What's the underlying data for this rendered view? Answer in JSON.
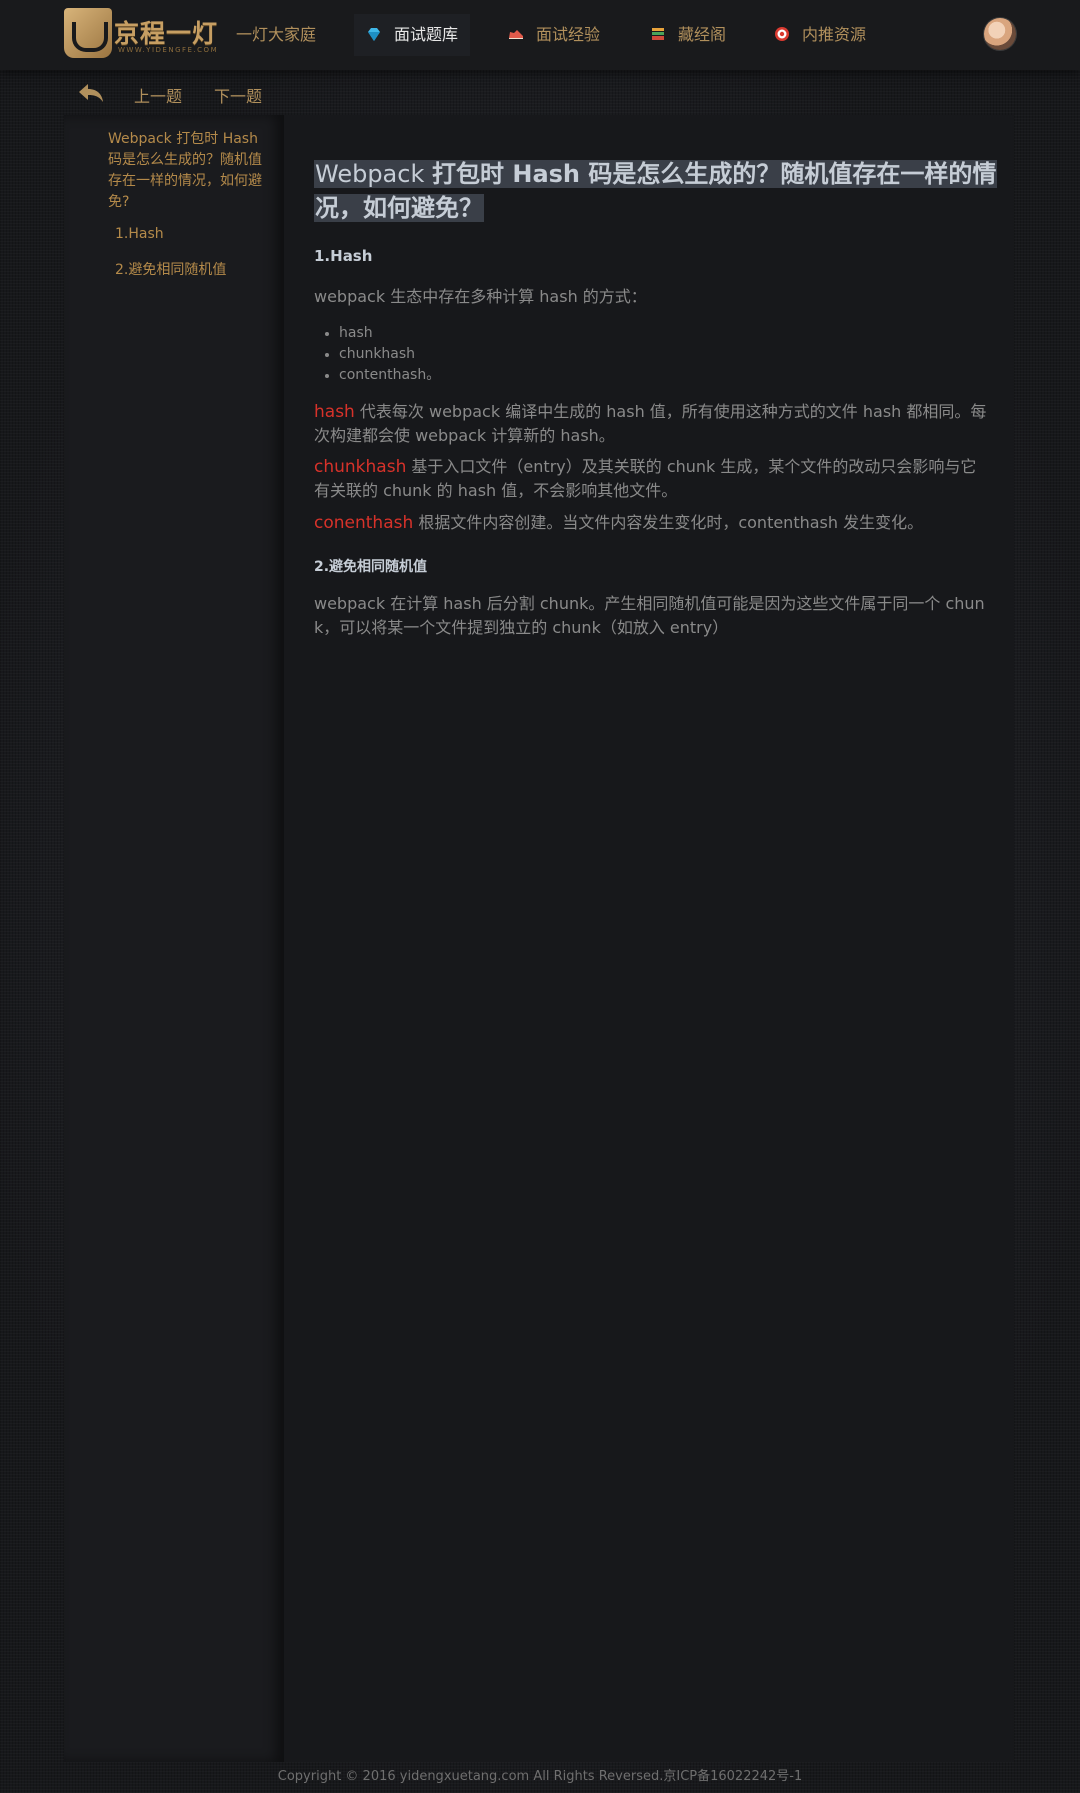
{
  "header": {
    "logo_text": "京程一灯",
    "logo_sub": "WWW.YIDENGFE.COM",
    "nav": [
      {
        "label": "一灯大家庭",
        "icon": "none"
      },
      {
        "label": "面试题库",
        "icon": "diamond-icon",
        "active": true
      },
      {
        "label": "面试经验",
        "icon": "shoe-icon"
      },
      {
        "label": "藏经阁",
        "icon": "books-icon"
      },
      {
        "label": "内推资源",
        "icon": "target-icon"
      }
    ]
  },
  "subnav": {
    "prev": "上一题",
    "next": "下一题"
  },
  "sidebar": {
    "title": "Webpack 打包时 Hash 码是怎么生成的？随机值存在一样的情况，如何避免?",
    "items": [
      "1.Hash",
      "2.避免相同随机值"
    ]
  },
  "content": {
    "title_plain": "Webpack ",
    "title_bold": "打包时 Hash 码是怎么生成的？随机值存在一样的情况，如何避免？",
    "section1": "1.Hash",
    "intro": "webpack 生态中存在多种计算 hash 的方式：",
    "bullets": [
      "hash",
      "chunkhash",
      "contenthash。"
    ],
    "hash_term": "hash",
    "hash_desc": " 代表每次 webpack 编译中生成的 hash 值，所有使用这种方式的文件 hash 都相同。每次构建都会使 webpack 计算新的 hash。",
    "chunkhash_term": "chunkhash",
    "chunkhash_desc": " 基于入口文件（entry）及其关联的 chunk 生成，某个文件的改动只会影响与它有关联的 chunk 的 hash 值，不会影响其他文件。",
    "contenthash_term": "conenthash",
    "contenthash_desc": " 根据文件内容创建。当文件内容发生变化时，contenthash 发生变化。",
    "section2": "2.避免相同随机值",
    "avoid_text": "webpack 在计算 hash 后分割 chunk。产生相同随机值可能是因为这些文件属于同一个 chunk，可以将某一个文件提到独立的 chunk（如放入 entry）"
  },
  "footer": "Copyright © 2016 yidengxuetang.com All Rights Reversed.京ICP备16022242号-1"
}
